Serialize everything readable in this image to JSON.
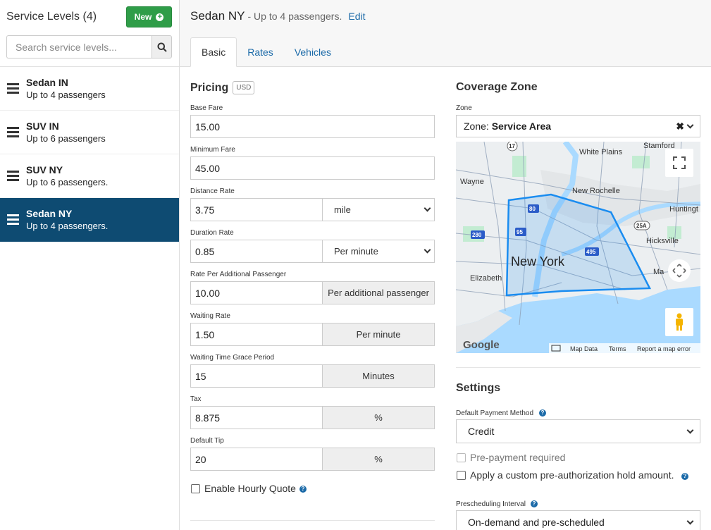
{
  "sidebar": {
    "title": "Service Levels (4)",
    "new_label": "New",
    "search_placeholder": "Search service levels...",
    "items": [
      {
        "name": "Sedan IN",
        "sub": "Up to 4 passengers"
      },
      {
        "name": "SUV IN",
        "sub": "Up to 6 passengers"
      },
      {
        "name": "SUV NY",
        "sub": "Up to 6 passengers."
      },
      {
        "name": "Sedan NY",
        "sub": "Up to 4 passengers.",
        "active": true
      }
    ]
  },
  "header": {
    "title": "Sedan NY",
    "subtitle": "- Up to 4 passengers.",
    "edit_label": "Edit"
  },
  "tabs": [
    "Basic",
    "Rates",
    "Vehicles"
  ],
  "pricing": {
    "title": "Pricing",
    "currency": "USD",
    "base_fare": {
      "label": "Base Fare",
      "value": "15.00"
    },
    "minimum_fare": {
      "label": "Minimum Fare",
      "value": "45.00"
    },
    "distance_rate": {
      "label": "Distance Rate",
      "value": "3.75",
      "unit": "mile"
    },
    "duration_rate": {
      "label": "Duration Rate",
      "value": "0.85",
      "unit": "Per minute"
    },
    "additional_passenger": {
      "label": "Rate Per Additional Passenger",
      "value": "10.00",
      "unit": "Per additional passenger"
    },
    "waiting_rate": {
      "label": "Waiting Rate",
      "value": "1.50",
      "unit": "Per minute"
    },
    "grace_period": {
      "label": "Waiting Time Grace Period",
      "value": "15",
      "unit": "Minutes"
    },
    "tax": {
      "label": "Tax",
      "value": "8.875",
      "unit": "%"
    },
    "default_tip": {
      "label": "Default Tip",
      "value": "20",
      "unit": "%"
    },
    "hourly_quote_label": "Enable Hourly Quote"
  },
  "coverage": {
    "title": "Coverage Zone",
    "zone_label": "Zone",
    "zone_prefix": "Zone:",
    "zone_value": "Service Area",
    "map": {
      "places": [
        "Stamford",
        "White Plains",
        "Wayne",
        "New Rochelle",
        "Huntingt",
        "Hicksville",
        "New York",
        "Elizabeth",
        "Ma"
      ],
      "shields": [
        "17",
        "80",
        "95",
        "280",
        "495",
        "25A"
      ],
      "footer": [
        "Map Data",
        "Terms",
        "Report a map error"
      ],
      "logo": "Google"
    }
  },
  "settings": {
    "title": "Settings",
    "payment_label": "Default Payment Method",
    "payment_value": "Credit",
    "prepayment_label": "Pre-payment required",
    "preauth_label": "Apply a custom pre-authorization hold amount.",
    "prescheduling_label": "Prescheduling Interval",
    "prescheduling_value": "On-demand and pre-scheduled"
  },
  "colors": {
    "primary": "#0e4b72",
    "new_button": "#2f9d48",
    "link": "#1b6aa8",
    "zone_stroke": "#1a8cf0"
  }
}
